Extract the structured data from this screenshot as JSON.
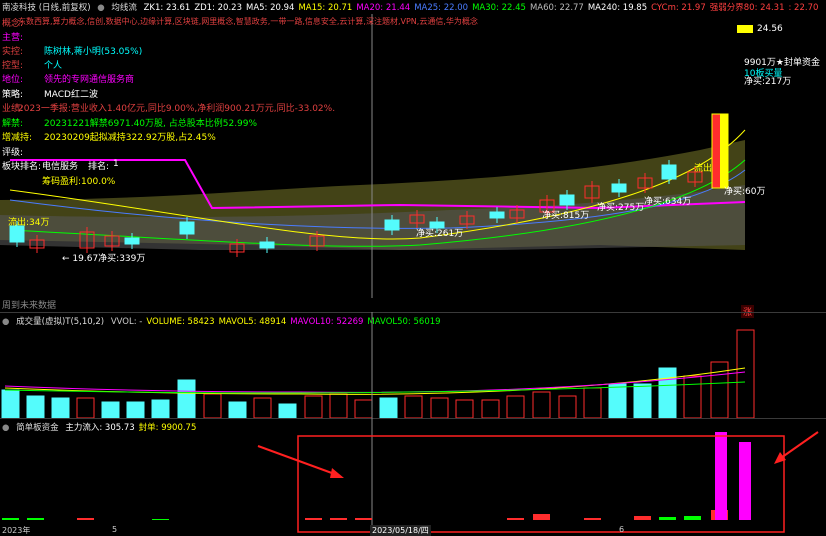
{
  "main_header": {
    "title": "南凌科技 (日线,前复权)",
    "indicator": "均线流",
    "items": [
      {
        "text": "ZK1: 23.61",
        "color": "#ffffff"
      },
      {
        "text": "ZD1: 20.23",
        "color": "#ffffff"
      },
      {
        "text": "MA5: 20.94",
        "color": "#ffffff"
      },
      {
        "text": "MA15: 20.71",
        "color": "#ffff00"
      },
      {
        "text": "MA20: 21.44",
        "color": "#ff00ff"
      },
      {
        "text": "MA25: 22.00",
        "color": "#4a7cff"
      },
      {
        "text": "MA30: 22.45",
        "color": "#00ff00"
      },
      {
        "text": "MA60: 22.77",
        "color": "#bbbbbb"
      },
      {
        "text": "MA240: 19.85",
        "color": "#ffffff"
      },
      {
        "text": "CYCm: 21.97",
        "color": "#ff4040"
      },
      {
        "text": "强弱分界80: 24.31",
        "color": "#ff4040"
      },
      {
        "text": ": 22.70",
        "color": "#ff4040"
      }
    ]
  },
  "info": {
    "concept": {
      "label": "概念:",
      "value": "东数西算,算力概念,信创,数据中心,边缘计算,区块链,网里概念,智慧政务,一带一路,信息安全,云计算,深注题材,VPN,云通信,华为概念"
    },
    "main_biz": {
      "label": "主营:",
      "value": ""
    },
    "actual": {
      "label": "实控:",
      "value": "陈树林,蒋小明(53.05%)"
    },
    "control": {
      "label": "控型:",
      "value": "个人"
    },
    "position": {
      "label": "地位:",
      "value": "领先的专网通信服务商"
    },
    "strategy": {
      "label": "策略:",
      "value": "MACD红二波"
    },
    "performance": {
      "label": "业绩:",
      "value": "2023一季报:营业收入1.40亿元,同比9.00%,净利润900.21万元,同比-33.02%."
    },
    "unlock": {
      "label": "解禁:",
      "value": "20231221解禁6971.40万股, 占总股本比例52.99%"
    },
    "reduce": {
      "label": "增减持:",
      "value": "20230209起拟减持322.92万股,占2.45%"
    },
    "rating": {
      "label": "评级:",
      "value": ""
    },
    "sector": {
      "label": "板块排名:",
      "value": "电信服务",
      "rank_label": "排名:",
      "rank_value": "1"
    },
    "profit": "筹码盈利:100.0%"
  },
  "annotations": {
    "top_price": "24.56",
    "seal_text": "9901万★封单资金",
    "ten_billion": "10板买量",
    "net_217": "净买:217万",
    "net_buy_60": "净买:60万",
    "outflow_top": "流出",
    "net_634": "净买:634万",
    "net_275": "净买:275万",
    "net_815": "净买:815万",
    "net_261": "净买:261万",
    "low_price": "← 19.67净买:339万",
    "left_outflow": "流出:34万",
    "future_label": "周到未来数据",
    "zhang": "涨"
  },
  "volume_header": {
    "title": "成交量(虚拟)T(5,10,2)",
    "items": [
      {
        "text": "VVOL: -",
        "color": "#cccccc"
      },
      {
        "text": "VOLUME: 58423",
        "color": "#ffff00"
      },
      {
        "text": "MAVOL5: 48914",
        "color": "#ffff00"
      },
      {
        "text": "MAVOL10: 52269",
        "color": "#ff00ff"
      },
      {
        "text": "MAVOL50: 56019",
        "color": "#00ff00"
      }
    ]
  },
  "capital_header": {
    "title": "简单板资金",
    "items": [
      {
        "text": "主力流入: 305.73",
        "color": "#ffffff"
      },
      {
        "text": "封单: 9900.75",
        "color": "#ffff00"
      }
    ]
  },
  "date_axis": {
    "year": "2023年",
    "m5": "5",
    "crosshair_date": "2023/05/18/四",
    "m6": "6"
  },
  "colors": {
    "up": "#ff2d2d",
    "down": "#54fcfc",
    "limit": "#ffff00",
    "magenta": "#ff00ff"
  }
}
